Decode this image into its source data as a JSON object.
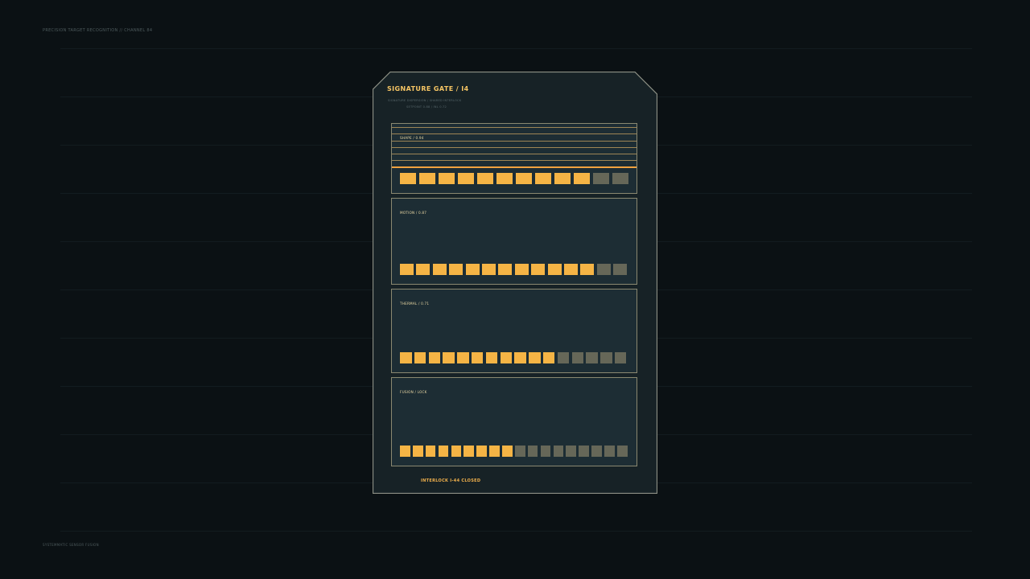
{
  "header": {
    "channel_label": "PRECISION TARGET RECOGNITION // CHANNEL 84"
  },
  "footer": {
    "signature_label": "SYSTEMMATIC SENSOR FUSION"
  },
  "panel": {
    "title": "SIGNATURE GATE / I4",
    "subtitle_line1": "SIGNATURE DISPERSION / SHARED INTERLOCK",
    "subtitle_line2": "SETPOINT 0.88 / INL 0.72",
    "status": "INTERLOCK I-44  CLOSED"
  },
  "sections": [
    {
      "label": "SHAPE / 0.94",
      "value": 0.94,
      "cells_total": 12,
      "cells_on": 10
    },
    {
      "label": "MOTION / 0.87",
      "value": 0.87,
      "cells_total": 14,
      "cells_on": 12
    },
    {
      "label": "THERMAL / 0.71",
      "value": 0.71,
      "cells_total": 16,
      "cells_on": 11
    },
    {
      "label": "FUSION / LOCK",
      "cells_total": 18,
      "cells_on": 9
    }
  ],
  "colors": {
    "background": "#0b1114",
    "panel_fill": "#172226",
    "panel_border": "#8d9085",
    "section_fill": "#1d2d34",
    "cell_on": "#f5b445",
    "cell_off": "#666758",
    "title_accent": "#f6c564"
  }
}
